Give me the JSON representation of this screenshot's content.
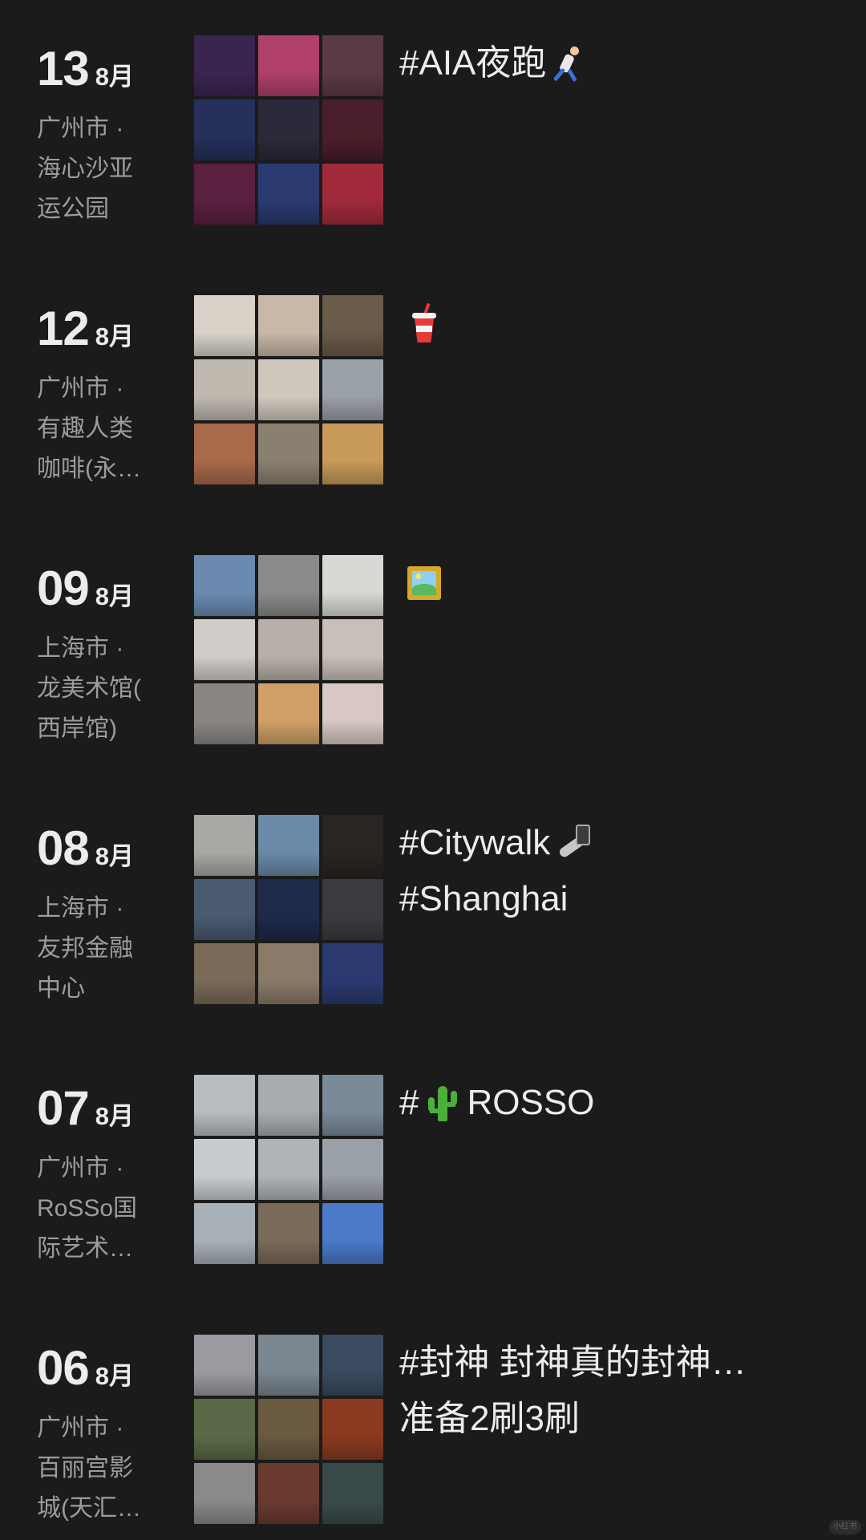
{
  "entries": [
    {
      "day": "13",
      "month": "8月",
      "location_lines": [
        "广州市 ·",
        "海心沙亚",
        "运公园"
      ],
      "caption_lines": [
        {
          "text": "#AIA夜跑",
          "emoji": "runner"
        }
      ],
      "photo_colors": [
        "#3a2550",
        "#b0406a",
        "#5a3a45",
        "#26305a",
        "#2a2a3a",
        "#4a1e2a",
        "#5a2040",
        "#2a3a70",
        "#a02a3a"
      ]
    },
    {
      "day": "12",
      "month": "8月",
      "location_lines": [
        "广州市 ·",
        "有趣人类",
        "咖啡(永…"
      ],
      "caption_lines": [
        {
          "text": "",
          "emoji": "cup"
        }
      ],
      "photo_colors": [
        "#d8d2c8",
        "#c8b8a8",
        "#6a5a48",
        "#bfb9b0",
        "#d0c8bc",
        "#9aa0a8",
        "#a86a4a",
        "#8a8070",
        "#c89a5a"
      ]
    },
    {
      "day": "09",
      "month": "8月",
      "location_lines": [
        "上海市 ·",
        "龙美术馆(",
        "西岸馆)"
      ],
      "caption_lines": [
        {
          "text": "",
          "emoji": "frame"
        }
      ],
      "photo_colors": [
        "#6a8ab0",
        "#8a8a88",
        "#d8d8d4",
        "#d0ccc8",
        "#b8b0a8",
        "#c8c0b8",
        "#8a8684",
        "#d0a068",
        "#d8c8c4"
      ]
    },
    {
      "day": "08",
      "month": "8月",
      "location_lines": [
        "上海市 ·",
        "友邦金融",
        "中心"
      ],
      "caption_lines": [
        {
          "text": "#Citywalk",
          "emoji": "selfie"
        },
        {
          "text": "#Shanghai",
          "emoji": ""
        }
      ],
      "photo_colors": [
        "#a8a8a4",
        "#6a8aa8",
        "#2a2520",
        "#4a5a70",
        "#1e2a4a",
        "#3a3a40",
        "#7a6a58",
        "#8a7a68",
        "#2a3a70"
      ]
    },
    {
      "day": "07",
      "month": "8月",
      "location_lines": [
        "广州市 ·",
        "RoSSo国",
        "际艺术…"
      ],
      "caption_lines": [
        {
          "text": "#",
          "emoji": "cactus",
          "after": "ROSSO"
        }
      ],
      "photo_colors": [
        "#b8bcc0",
        "#a8acb0",
        "#7a8a98",
        "#c8ccd0",
        "#b0b4b8",
        "#9aa0a8",
        "#a8b0b8",
        "#7a6a5a",
        "#4a7ac8"
      ]
    },
    {
      "day": "06",
      "month": "8月",
      "location_lines": [
        "广州市 ·",
        "百丽宫影",
        "城(天汇…"
      ],
      "caption_lines": [
        {
          "text": "#封神 封神真的封神…",
          "emoji": ""
        },
        {
          "text": "准备2刷3刷",
          "emoji": ""
        }
      ],
      "photo_colors": [
        "#9a9aa0",
        "#7a8690",
        "#3a4a60",
        "#5a6a48",
        "#6a5a40",
        "#8a3a20",
        "#8a8a88",
        "#6a3a30",
        "#3a4a4a"
      ]
    }
  ],
  "watermark": "小红书"
}
